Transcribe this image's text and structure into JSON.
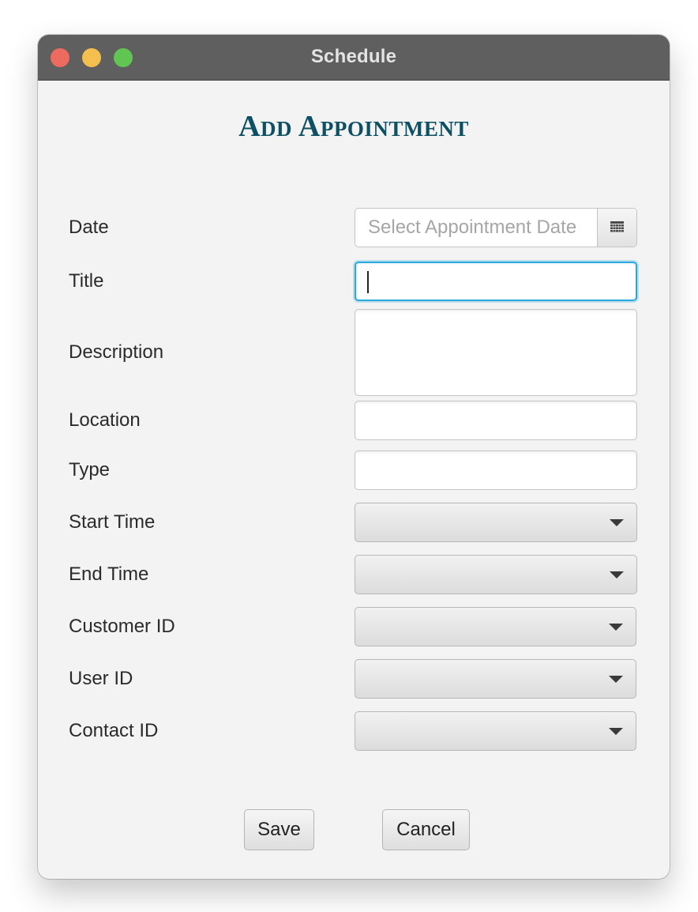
{
  "window": {
    "title": "Schedule"
  },
  "form": {
    "heading": "Add Appointment",
    "fields": {
      "date": {
        "label": "Date",
        "placeholder": "Select Appointment Date",
        "value": ""
      },
      "title": {
        "label": "Title",
        "value": ""
      },
      "description": {
        "label": "Description",
        "value": ""
      },
      "location": {
        "label": "Location",
        "value": ""
      },
      "type": {
        "label": "Type",
        "value": ""
      },
      "start_time": {
        "label": "Start Time",
        "selected": ""
      },
      "end_time": {
        "label": "End Time",
        "selected": ""
      },
      "customer_id": {
        "label": "Customer ID",
        "selected": ""
      },
      "user_id": {
        "label": "User ID",
        "selected": ""
      },
      "contact_id": {
        "label": "Contact ID",
        "selected": ""
      }
    },
    "focused_field": "title"
  },
  "buttons": {
    "save": "Save",
    "cancel": "Cancel"
  },
  "icons": {
    "date_picker": "calendar-icon",
    "combo_arrow": "chevron-down-icon"
  },
  "colors": {
    "heading": "#0d4f63",
    "focus_ring": "#2aa9de",
    "titlebar": "#5f5f5f"
  }
}
